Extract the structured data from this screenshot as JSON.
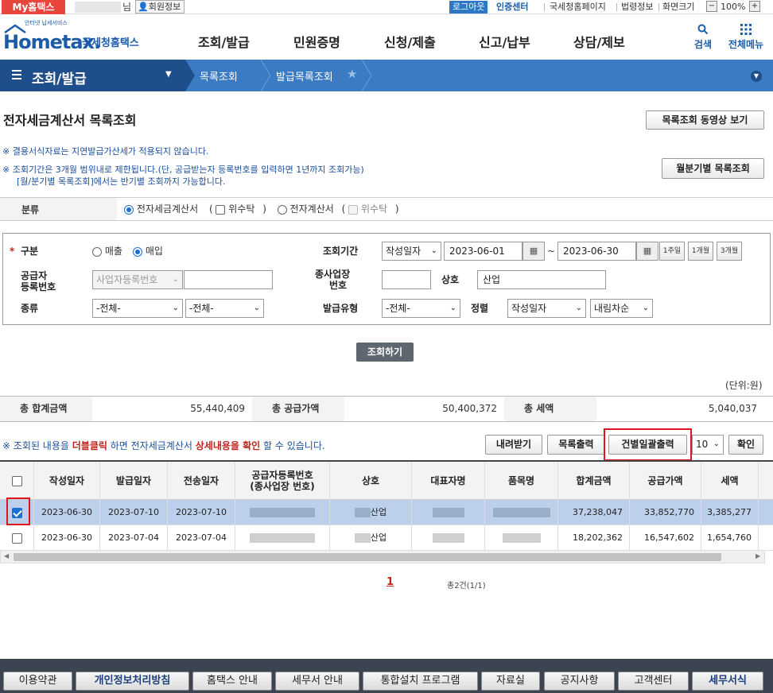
{
  "topbar": {
    "myhome": "My홈택스",
    "user_suffix": "님",
    "member_info": "회원정보",
    "logout": "로그아웃",
    "cert_center": "인증센터",
    "links": [
      "국세청홈페이지",
      "법령정보",
      "화면크기"
    ],
    "zoom_minus": "−",
    "zoom": "100%",
    "zoom_plus": "+"
  },
  "header": {
    "logo_text": "Hometax.",
    "logo_tagline": "안터넷 납세서비스",
    "logo_kr": "국세청홈택스",
    "menu": [
      "조회/발급",
      "민원증명",
      "신청/제출",
      "신고/납부",
      "상담/제보"
    ],
    "search": "검색",
    "all_menu": "전체메뉴"
  },
  "nav": {
    "title": "조회/발급",
    "crumbs": [
      "목록조회",
      "발급목록조회"
    ]
  },
  "page": {
    "title": "전자세금계산서 목록조회",
    "video_btn": "목록조회 동영상 보기",
    "half_btn": "월분기별 목록조회",
    "notes": [
      "※ 결용서식자료는 지연발급가산세가 적용되지 않습니다.",
      "※ 조회기간은 3개월 범위내로 제한됩니다.(단, 공급받는자 등록번호를 입력하면 1년까지 조회가능)",
      "[월/분기별 목록조회]에서는 반기별 조회까지 가능합니다."
    ]
  },
  "classify": {
    "label": "분류",
    "opt1": "전자세금계산서",
    "opt1_sub": "위수탁",
    "opt2": "전자계산서",
    "opt2_sub": "위수탁",
    "paren_open": "(",
    "paren_close": ")"
  },
  "search": {
    "gubun_label": "구분",
    "required_mark": "*",
    "sale": "매출",
    "purchase": "매입",
    "supplier_label_1": "공급자",
    "supplier_label_2": "등록번호",
    "supplier_select": "사업자등록번호",
    "kind_label": "종류",
    "kind1": "-전체-",
    "kind2": "-전체-",
    "period_label": "조회기간",
    "date_type": "작성일자",
    "date_from": "2023-06-01",
    "tilde": "~",
    "date_to": "2023-06-30",
    "p1": "1주일",
    "p2": "1개월",
    "p3": "3개월",
    "branch_label_1": "종사업장",
    "branch_label_2": "번호",
    "company_label": "상호",
    "company_value": "산업",
    "issue_type_label": "발급유형",
    "issue_type": "-전체-",
    "sort_label": "정렬",
    "sort_field": "작성일자",
    "sort_order": "내림차순",
    "submit": "조회하기",
    "unit": "(단위:원)"
  },
  "totals": {
    "total_label": "총 합계금액",
    "total": "55,440,409",
    "supply_label": "총 공급가액",
    "supply": "50,400,372",
    "tax_label": "총 세액",
    "tax": "5,040,037"
  },
  "info": {
    "p1": "※ 조회된 내용을 ",
    "dbl": "더블클릭",
    "p2": " 하면 전자세금계산서 ",
    "detail": "상세내용을 확인",
    "p3": " 할 수 있습니다."
  },
  "actions": {
    "download": "내려받기",
    "print_list": "목록출력",
    "print_each": "건별일괄출력",
    "page_size": "10",
    "confirm": "확인"
  },
  "table": {
    "headers": [
      "작성일자",
      "발급일자",
      "전송일자",
      "공급자등록번호\n(종사업장 번호)",
      "상호",
      "대표자명",
      "품목명",
      "합계금액",
      "공급가액",
      "세액"
    ],
    "rows": [
      {
        "selected": true,
        "written": "2023-06-30",
        "issued": "2023-07-10",
        "sent": "2023-07-10",
        "company": "산업",
        "total": "37,238,047",
        "supply": "33,852,770",
        "tax": "3,385,277"
      },
      {
        "selected": false,
        "written": "2023-06-30",
        "issued": "2023-07-04",
        "sent": "2023-07-04",
        "company": "산업",
        "total": "18,202,362",
        "supply": "16,547,602",
        "tax": "1,654,760"
      }
    ]
  },
  "pagination": {
    "current": "1",
    "summary": "총2건(1/1)"
  },
  "footer": [
    "이용약관",
    "개인정보처리방침",
    "홈택스 안내",
    "세무서 안내",
    "통합설치 프로그램",
    "자료실",
    "공지사항",
    "고객센터",
    "세무서식"
  ],
  "colors": {
    "brand": "#1d5aa8",
    "nav_bg": "#3a7bc3",
    "nav_dark": "#1f4f8a",
    "highlight": "#e0141e",
    "selected_row": "#bcd0ec"
  }
}
